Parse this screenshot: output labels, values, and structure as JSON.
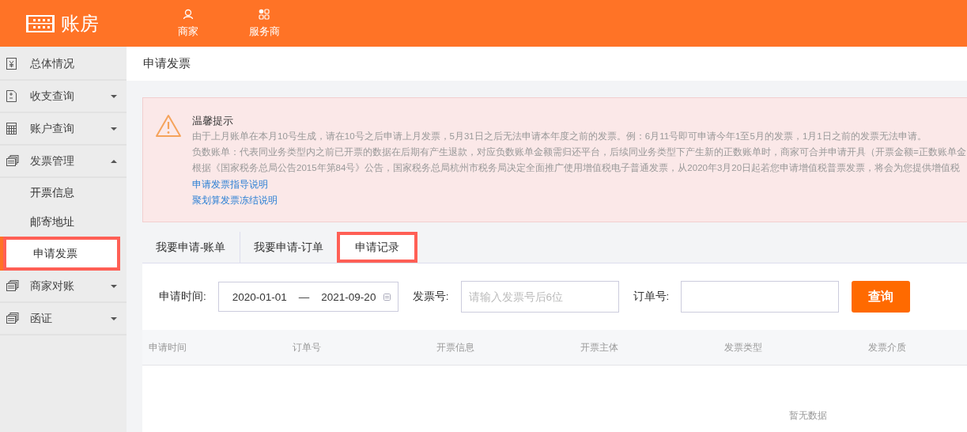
{
  "header": {
    "logo_text": "账房",
    "nav": [
      {
        "label": "商家"
      },
      {
        "label": "服务商"
      }
    ]
  },
  "sidebar": {
    "items": [
      {
        "label": "总体情况",
        "kind": "link"
      },
      {
        "label": "收支查询",
        "kind": "group",
        "expanded": false
      },
      {
        "label": "账户查询",
        "kind": "group",
        "expanded": false
      },
      {
        "label": "发票管理",
        "kind": "group",
        "expanded": true,
        "children": [
          {
            "label": "开票信息",
            "selected": false
          },
          {
            "label": "邮寄地址",
            "selected": false
          },
          {
            "label": "申请发票",
            "selected": true
          }
        ]
      },
      {
        "label": "商家对账",
        "kind": "group",
        "expanded": false
      },
      {
        "label": "函证",
        "kind": "group",
        "expanded": false
      }
    ]
  },
  "page_title": "申请发票",
  "notice": {
    "title": "温馨提示",
    "lines": [
      "由于上月账单在本月10号生成，请在10号之后申请上月发票，5月31日之后无法申请本年度之前的发票。例：6月11号即可申请今年1至5月的发票，1月1日之前的发票无法申请。",
      "负数账单：代表同业务类型内之前已开票的数据在后期有产生退款，对应负数账单金额需归还平台，后续同业务类型下产生新的正数账单时，商家可合并申请开具（开票金额=正数账单金",
      "根据《国家税务总局公告2015年第84号》公告，国家税务总局杭州市税务局决定全面推广使用增值税电子普通发票，从2020年3月20日起若您申请增值税普票发票，将会为您提供增值税"
    ],
    "links": [
      "申请发票指导说明",
      "聚划算发票冻结说明"
    ]
  },
  "tabs": [
    {
      "label": "我要申请-账单",
      "selected": false
    },
    {
      "label": "我要申请-订单",
      "selected": false
    },
    {
      "label": "申请记录",
      "selected": true
    }
  ],
  "filters": {
    "date_label": "申请时间:",
    "date_start": "2020-01-01",
    "date_separator": "—",
    "date_end": "2021-09-20",
    "invoice_label": "发票号:",
    "invoice_placeholder": "请输入发票号后6位",
    "order_label": "订单号:",
    "search_button": "查询"
  },
  "table": {
    "columns": [
      "申请时间",
      "订单号",
      "开票信息",
      "开票主体",
      "发票类型",
      "发票介质"
    ],
    "empty_text": "暂无数据"
  }
}
